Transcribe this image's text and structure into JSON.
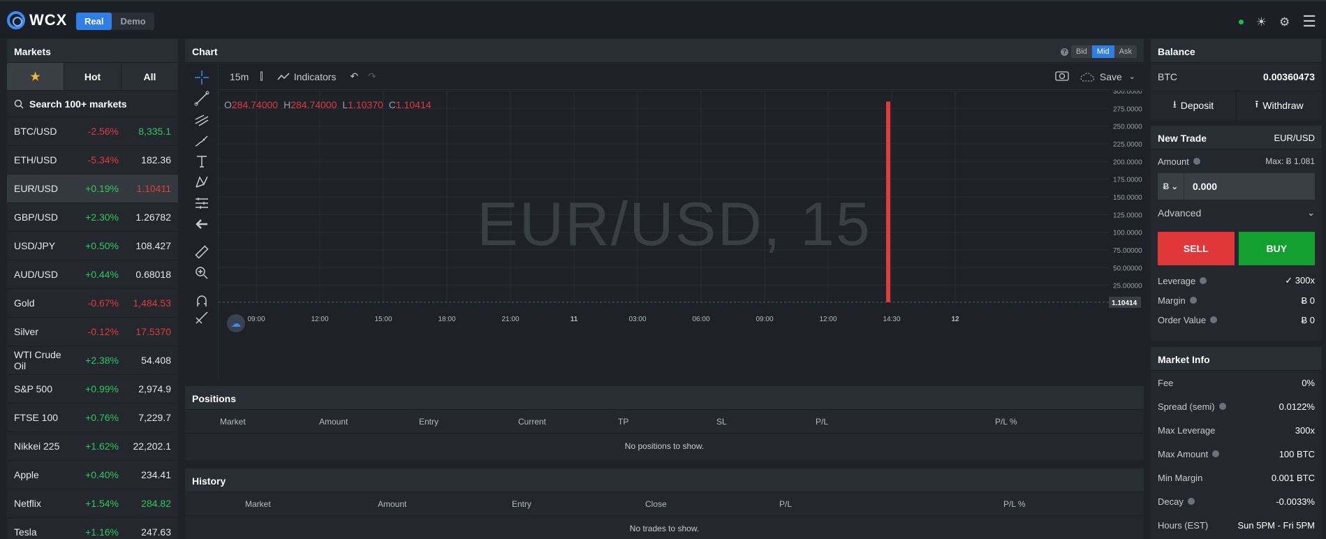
{
  "brand": {
    "name": "WCX"
  },
  "mode": {
    "real": "Real",
    "demo": "Demo"
  },
  "markets": {
    "title": "Markets",
    "tabs": [
      "Hot",
      "All"
    ],
    "search_placeholder": "Search 100+ markets",
    "rows": [
      {
        "name": "BTC/USD",
        "change": "-2.56%",
        "price": "8,335.1",
        "dir": "down",
        "pdir": "up"
      },
      {
        "name": "ETH/USD",
        "change": "-5.34%",
        "price": "182.36",
        "dir": "down",
        "pdir": "flat"
      },
      {
        "name": "EUR/USD",
        "change": "+0.19%",
        "price": "1.10411",
        "dir": "up",
        "pdir": "down"
      },
      {
        "name": "GBP/USD",
        "change": "+2.30%",
        "price": "1.26782",
        "dir": "up",
        "pdir": "flat"
      },
      {
        "name": "USD/JPY",
        "change": "+0.50%",
        "price": "108.427",
        "dir": "up",
        "pdir": "flat"
      },
      {
        "name": "AUD/USD",
        "change": "+0.44%",
        "price": "0.68018",
        "dir": "up",
        "pdir": "flat"
      },
      {
        "name": "Gold",
        "change": "-0.67%",
        "price": "1,484.53",
        "dir": "down",
        "pdir": "down"
      },
      {
        "name": "Silver",
        "change": "-0.12%",
        "price": "17.5370",
        "dir": "down",
        "pdir": "down"
      },
      {
        "name": "WTI Crude Oil",
        "change": "+2.38%",
        "price": "54.408",
        "dir": "up",
        "pdir": "flat"
      },
      {
        "name": "S&P 500",
        "change": "+0.99%",
        "price": "2,974.9",
        "dir": "up",
        "pdir": "flat"
      },
      {
        "name": "FTSE 100",
        "change": "+0.76%",
        "price": "7,229.7",
        "dir": "up",
        "pdir": "flat"
      },
      {
        "name": "Nikkei 225",
        "change": "+1.62%",
        "price": "22,202.1",
        "dir": "up",
        "pdir": "flat"
      },
      {
        "name": "Apple",
        "change": "+0.40%",
        "price": "234.41",
        "dir": "up",
        "pdir": "flat"
      },
      {
        "name": "Netflix",
        "change": "+1.54%",
        "price": "284.82",
        "dir": "up",
        "pdir": "up"
      },
      {
        "name": "Tesla",
        "change": "+1.16%",
        "price": "247.63",
        "dir": "up",
        "pdir": "flat"
      }
    ]
  },
  "chart": {
    "title": "Chart",
    "price_sources": [
      "Bid",
      "Mid",
      "Ask"
    ],
    "active_source": "Mid",
    "interval": "15m",
    "indicators_label": "Indicators",
    "save_label": "Save",
    "watermark": "EUR/USD, 15",
    "ohlc": {
      "o": "284.74000",
      "h": "284.74000",
      "l": "1.10370",
      "c": "1.10414"
    },
    "last_price": "1.10414"
  },
  "chart_data": {
    "type": "bar",
    "title": "",
    "x_ticks": [
      "09:00",
      "12:00",
      "15:00",
      "18:00",
      "21:00",
      "11",
      "03:00",
      "06:00",
      "09:00",
      "12:00",
      "14:30",
      "12"
    ],
    "y_ticks": [
      "300.0000",
      "275.0000",
      "250.0000",
      "225.0000",
      "200.0000",
      "175.0000",
      "150.0000",
      "125.0000",
      "100.0000",
      "75.00000",
      "50.00000",
      "25.00000"
    ],
    "ylim": [
      0,
      300
    ],
    "series": [
      {
        "values": [
          284.74
        ]
      }
    ],
    "last_value": 1.10414
  },
  "positions": {
    "title": "Positions",
    "columns": [
      "Market",
      "Amount",
      "Entry",
      "Current",
      "TP",
      "SL",
      "P/L",
      "P/L %"
    ],
    "empty": "No positions to show."
  },
  "history": {
    "title": "History",
    "columns": [
      "Market",
      "Amount",
      "Entry",
      "Close",
      "P/L",
      "P/L %"
    ],
    "empty": "No trades to show."
  },
  "balance": {
    "title": "Balance",
    "currency": "BTC",
    "value": "0.00360473",
    "deposit": "Deposit",
    "withdraw": "Withdraw"
  },
  "trade": {
    "title": "New Trade",
    "pair": "EUR/USD",
    "amount_label": "Amount",
    "max": "Max: Ƀ 1.081",
    "currency_symbol": "Ƀ",
    "amount_value": "0.000",
    "advanced": "Advanced",
    "sell": "SELL",
    "buy": "BUY",
    "leverage_label": "Leverage",
    "leverage_value": "✓ 300x",
    "margin_label": "Margin",
    "margin_value": "Ƀ 0",
    "order_value_label": "Order Value",
    "order_value": "Ƀ 0"
  },
  "market_info": {
    "title": "Market Info",
    "rows": [
      {
        "label": "Fee",
        "value": "0%",
        "help": false
      },
      {
        "label": "Spread (semi)",
        "value": "0.0122%",
        "help": true
      },
      {
        "label": "Max Leverage",
        "value": "300x",
        "help": false
      },
      {
        "label": "Max Amount",
        "value": "100 BTC",
        "help": true
      },
      {
        "label": "Min Margin",
        "value": "0.001 BTC",
        "help": false
      },
      {
        "label": "Decay",
        "value": "-0.0033%",
        "help": true
      },
      {
        "label": "Hours (EST)",
        "value": "Sun 5PM - Fri 5PM",
        "help": false
      }
    ]
  }
}
